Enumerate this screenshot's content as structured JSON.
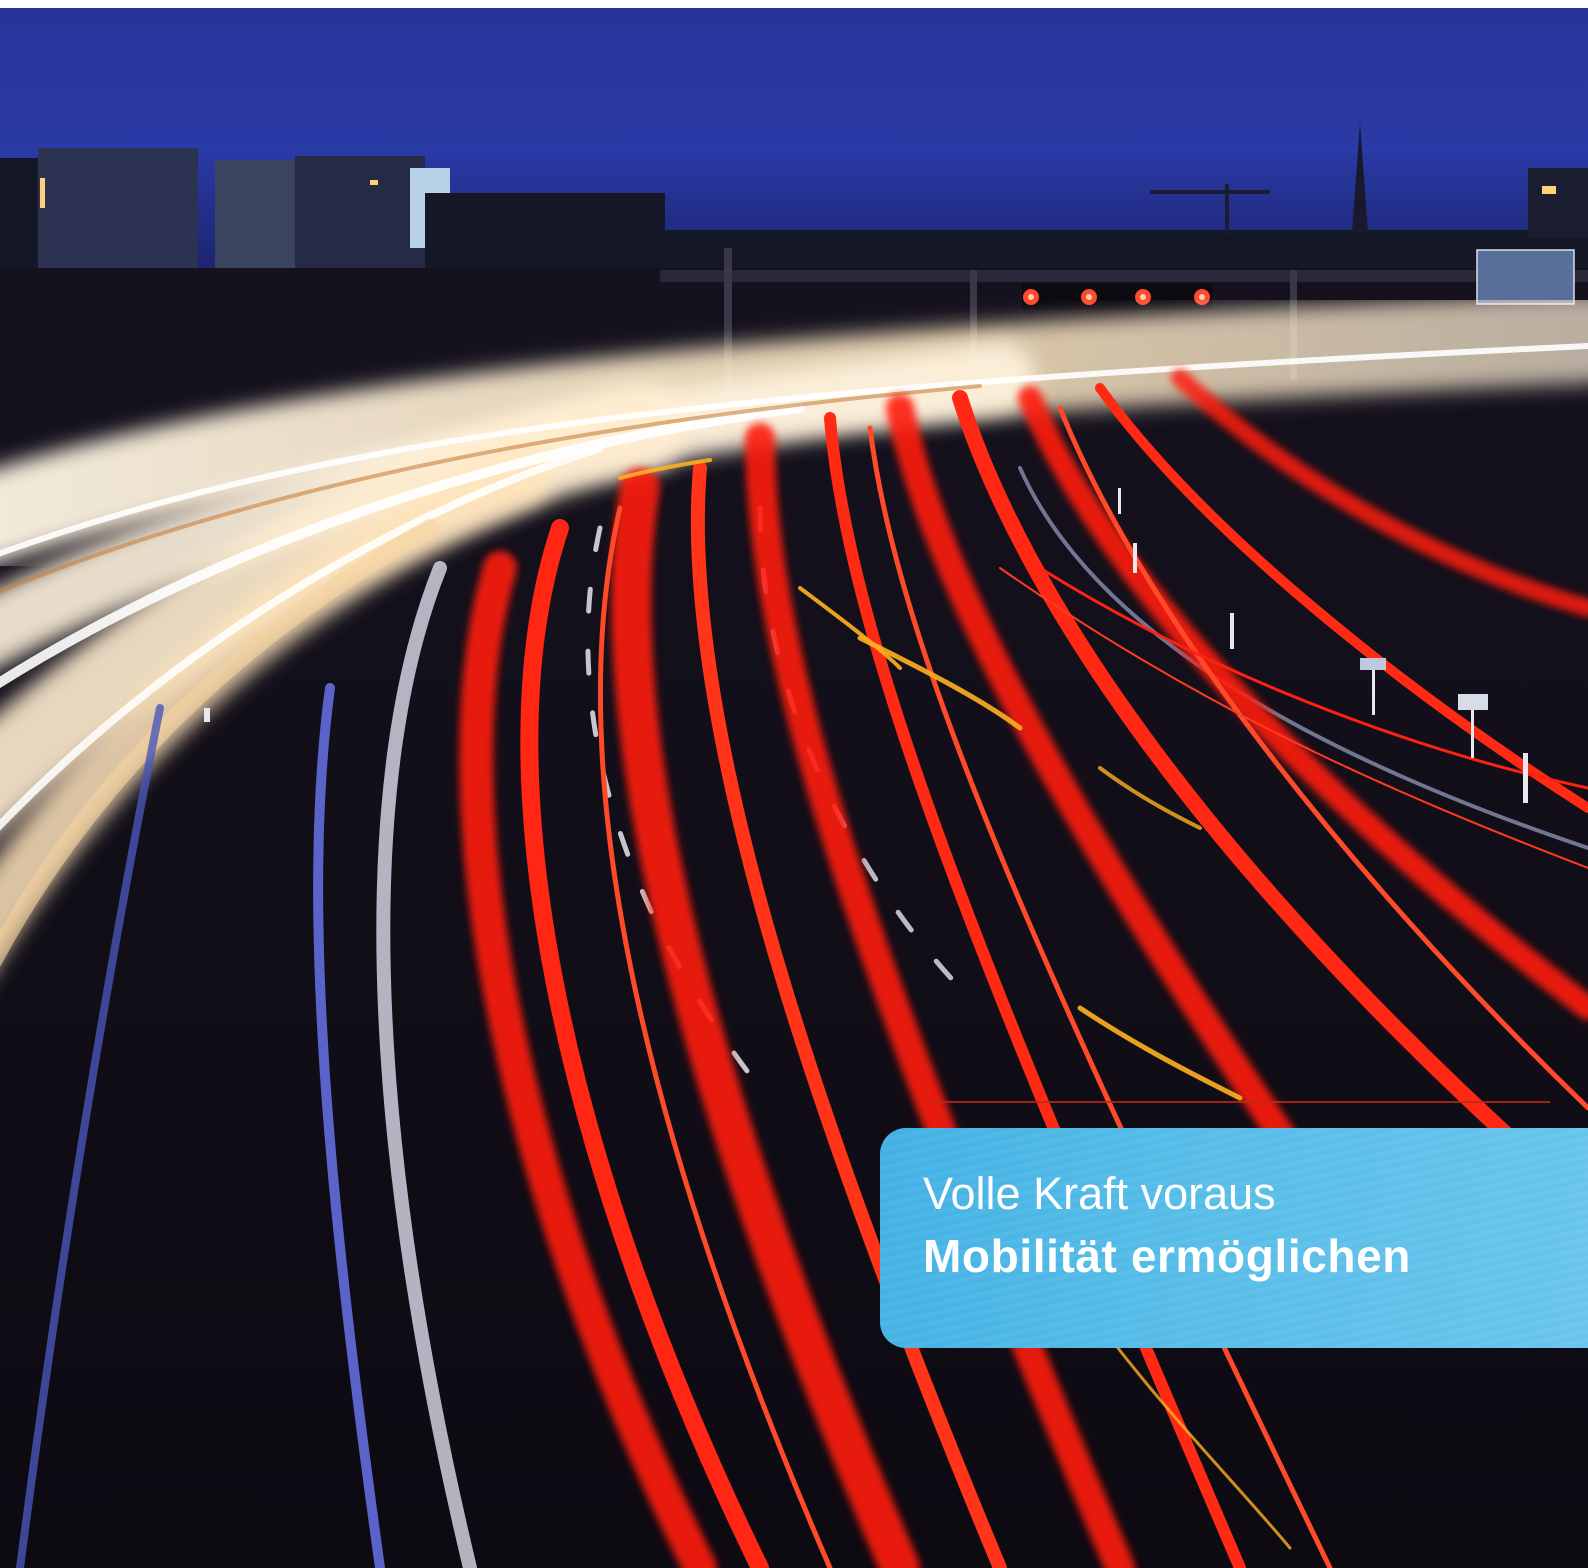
{
  "caption": {
    "line1": "Volle Kraft voraus",
    "line2": "Mobilität ermöglichen"
  },
  "colors": {
    "sky": "#29339a",
    "caption_box": "#4fb7e6",
    "tail_lights": "#ff1a10",
    "head_lights": "#fff2d8"
  }
}
